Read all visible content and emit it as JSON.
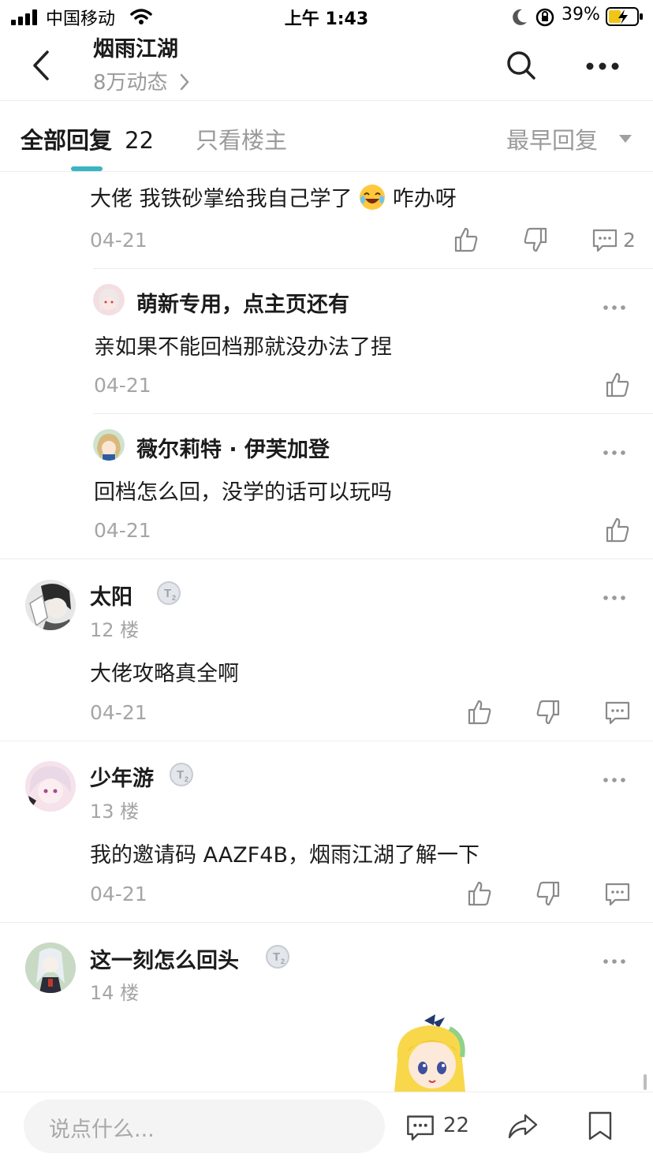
{
  "status_bar": {
    "carrier": "中国移动",
    "time": "上午 1:43",
    "battery": "39%"
  },
  "header": {
    "title": "烟雨江湖",
    "subtitle": "8万动态"
  },
  "tabs": {
    "all_label": "全部回复",
    "all_count": "22",
    "op_only": "只看楼主",
    "sort": "最早回复"
  },
  "reply_top": {
    "text": "大佬 我铁砂掌给我自己学了",
    "text_after": "咋办呀",
    "date": "04-21",
    "comment_count": "2"
  },
  "sub_replies": [
    {
      "name": "萌新专用，点主页还有",
      "text": "亲如果不能回档那就没办法了捏",
      "date": "04-21"
    },
    {
      "name": "薇尔莉特 · 伊芙加登",
      "text": "回档怎么回，没学的话可以玩吗",
      "date": "04-21"
    }
  ],
  "posts": [
    {
      "name": "太阳",
      "badge": "T2",
      "floor": "12 楼",
      "text": "大佬攻略真全啊",
      "date": "04-21"
    },
    {
      "name": "少年游",
      "badge": "T2",
      "floor": "13 楼",
      "text": "我的邀请码 AAZF4B，烟雨江湖了解一下",
      "date": "04-21"
    },
    {
      "name": "这一刻怎么回头",
      "badge": "T2",
      "floor": "14 楼"
    }
  ],
  "bottom_bar": {
    "placeholder": "说点什么...",
    "comment_count": "22"
  },
  "colors": {
    "accent": "#3bb4c4",
    "text": "#1c1c1c",
    "muted": "#a5a5a5"
  },
  "icons": [
    "back-icon",
    "search-icon",
    "more-icon",
    "thumb-up-icon",
    "thumb-down-icon",
    "comment-icon",
    "share-icon",
    "bookmark-icon",
    "badge-t2-icon"
  ]
}
